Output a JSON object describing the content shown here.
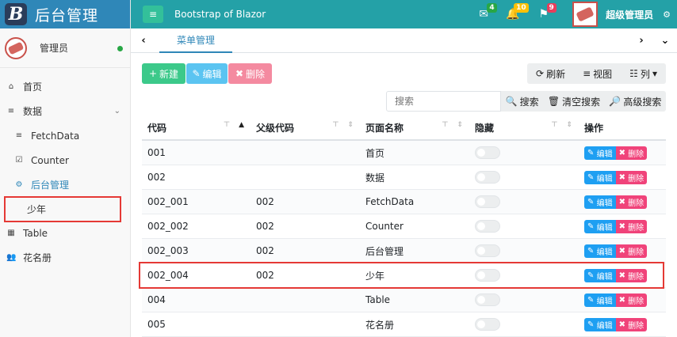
{
  "brand": {
    "logo_letter": "B",
    "title": "后台管理"
  },
  "user": {
    "name": "管理员",
    "status_color": "#28a745"
  },
  "sidebar": {
    "items": [
      {
        "label": "首页",
        "icon": "home-icon"
      },
      {
        "label": "数据",
        "icon": "database-icon",
        "caret": "⌄"
      },
      {
        "label": "FetchData",
        "icon": "database-icon"
      },
      {
        "label": "Counter",
        "icon": "check-square-icon"
      },
      {
        "label": "后台管理",
        "icon": "cogs-icon"
      },
      {
        "label": "少年"
      },
      {
        "label": "Table",
        "icon": "table-icon"
      },
      {
        "label": "花名册",
        "icon": "users-icon"
      }
    ]
  },
  "topbar": {
    "menu_icon": "bars-icon",
    "title": "Bootstrap of Blazor",
    "badges": {
      "mail": "4",
      "bell": "10",
      "flag": "9"
    },
    "user_name": "超级管理员"
  },
  "tabs": {
    "active": "菜单管理"
  },
  "toolbar": {
    "new": "新建",
    "edit": "编辑",
    "delete": "删除",
    "refresh": "刷新",
    "view": "视图",
    "columns": "列"
  },
  "search": {
    "placeholder": "搜索",
    "search_btn": "搜索",
    "clear_btn": "清空搜索",
    "advanced_btn": "高级搜索"
  },
  "table": {
    "headers": {
      "code": "代码",
      "parent": "父级代码",
      "name": "页面名称",
      "hidden": "隐藏",
      "actions": "操作"
    },
    "action_edit": "编辑",
    "action_delete": "删除",
    "rows": [
      {
        "code": "001",
        "parent": "",
        "name": "首页",
        "hidden": false
      },
      {
        "code": "002",
        "parent": "",
        "name": "数据",
        "hidden": false
      },
      {
        "code": "002_001",
        "parent": "002",
        "name": "FetchData",
        "hidden": false
      },
      {
        "code": "002_002",
        "parent": "002",
        "name": "Counter",
        "hidden": false
      },
      {
        "code": "002_003",
        "parent": "002",
        "name": "后台管理",
        "hidden": false
      },
      {
        "code": "002_004",
        "parent": "002",
        "name": "少年",
        "hidden": false
      },
      {
        "code": "004",
        "parent": "",
        "name": "Table",
        "hidden": false
      },
      {
        "code": "005",
        "parent": "",
        "name": "花名册",
        "hidden": false
      }
    ]
  },
  "colors": {
    "header": "#24a1a7",
    "brand": "#2f87b8",
    "highlight": "#e53935"
  }
}
